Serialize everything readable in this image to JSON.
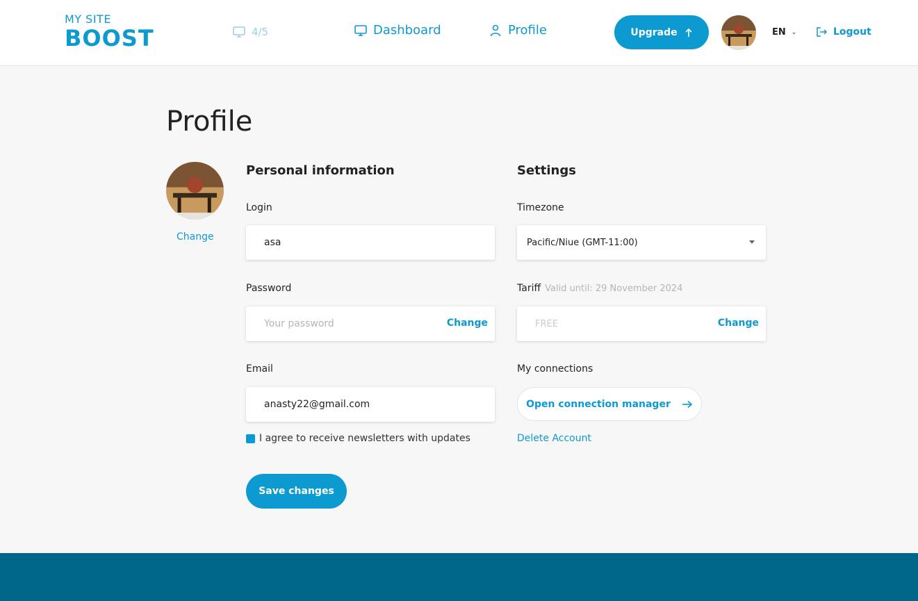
{
  "header": {
    "logo_small": "MY SITE",
    "logo_big": "BOOST",
    "counter": "4/5",
    "nav_dashboard": "Dashboard",
    "nav_profile": "Profile",
    "upgrade_label": "Upgrade",
    "language": "EN",
    "logout_label": "Logout"
  },
  "page": {
    "title": "Profile",
    "avatar_change": "Change"
  },
  "personal": {
    "title": "Personal information",
    "login_label": "Login",
    "login_value": "asa",
    "password_label": "Password",
    "password_placeholder": "Your password",
    "password_change": "Change",
    "email_label": "Email",
    "email_value": "anasty22@gmail.com",
    "newsletter_label": "I agree to receive newsletters with updates",
    "save_label": "Save changes"
  },
  "settings": {
    "title": "Settings",
    "timezone_label": "Timezone",
    "timezone_value": "Pacific/Niue (GMT-11:00)",
    "tariff_label": "Tariff",
    "tariff_valid": "Valid until: 29 November 2024",
    "tariff_value": "FREE",
    "tariff_change": "Change",
    "connections_label": "My connections",
    "connections_button": "Open connection manager",
    "delete_account": "Delete Account"
  },
  "colors": {
    "accent": "#0d9ad0",
    "footer": "#00668a",
    "background": "#f7f7f7"
  }
}
